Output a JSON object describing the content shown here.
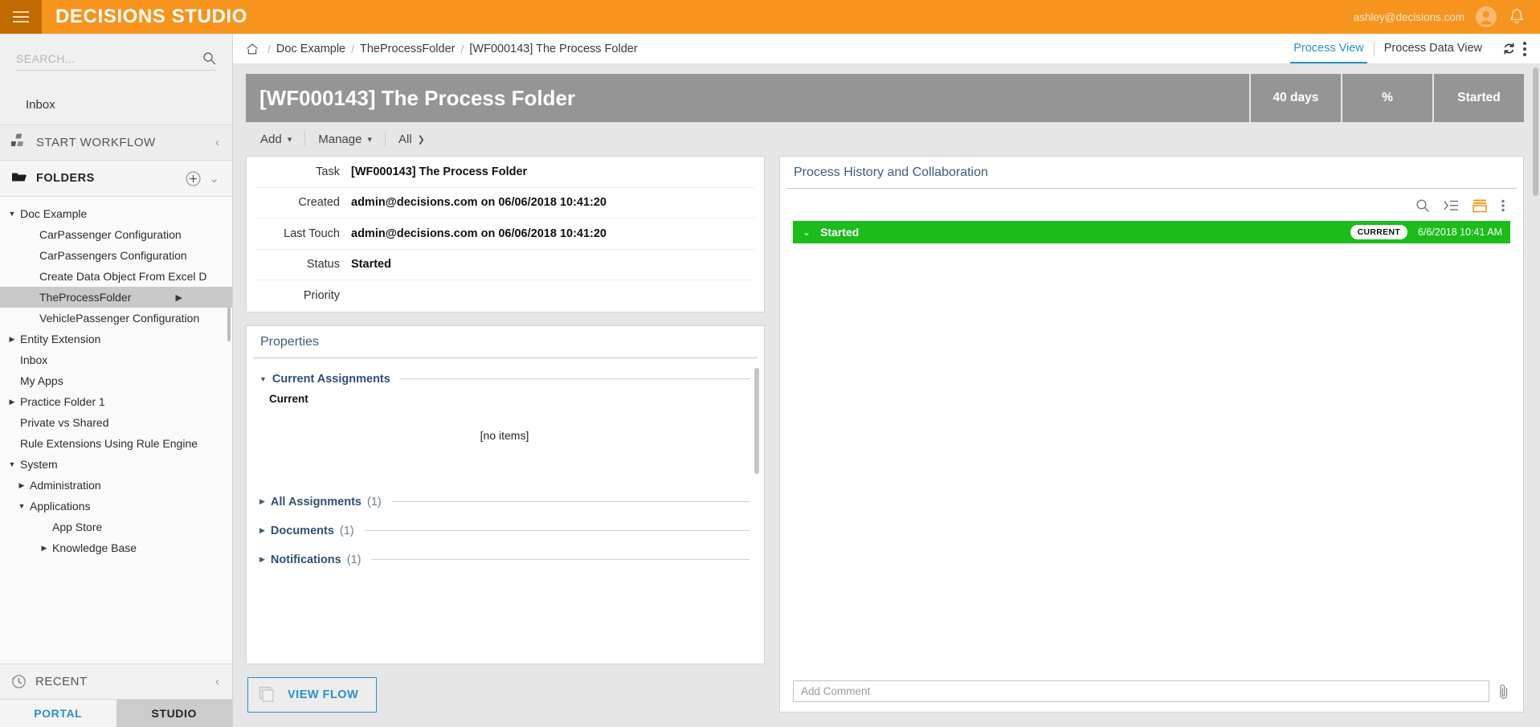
{
  "topbar": {
    "brand": "DECISIONS STUDIO",
    "user_email": "ashley@decisions.com",
    "menu_icon": "hamburger-icon",
    "avatar_icon": "user-avatar-icon",
    "bell_icon": "notification-bell-icon",
    "accent_color": "#f7941e",
    "menu_block_color": "#c06a00"
  },
  "sidebar": {
    "search": {
      "placeholder": "SEARCH...",
      "value": "",
      "icon": "search-icon"
    },
    "inbox_label": "Inbox",
    "start_workflow": {
      "label": "START WORKFLOW",
      "icon": "workflow-blocks-icon",
      "collapse": "‹"
    },
    "folders": {
      "label": "FOLDERS",
      "icon": "folder-icon",
      "add": "+",
      "chevron": "⌄"
    },
    "tree": [
      {
        "label": "Doc Example",
        "depth": 0,
        "arrow": "▼",
        "selected": false
      },
      {
        "label": "CarPassenger Configuration",
        "depth": 1,
        "arrow": "",
        "selected": false
      },
      {
        "label": "CarPassengers Configuration",
        "depth": 1,
        "arrow": "",
        "selected": false
      },
      {
        "label": "Create Data Object From Excel D",
        "depth": 1,
        "arrow": "",
        "selected": false
      },
      {
        "label": "TheProcessFolder",
        "depth": 1,
        "arrow": "",
        "selected": true,
        "right_arrow": "▶"
      },
      {
        "label": "VehiclePassenger Configuration",
        "depth": 1,
        "arrow": "",
        "selected": false
      },
      {
        "label": "Entity Extension",
        "depth": 0,
        "arrow": "▶",
        "selected": false
      },
      {
        "label": "Inbox",
        "depth": 0,
        "arrow": "",
        "selected": false
      },
      {
        "label": "My Apps",
        "depth": 0,
        "arrow": "",
        "selected": false
      },
      {
        "label": "Practice Folder 1",
        "depth": 0,
        "arrow": "▶",
        "selected": false
      },
      {
        "label": "Private vs Shared",
        "depth": 0,
        "arrow": "",
        "selected": false
      },
      {
        "label": "Rule Extensions Using Rule Engine",
        "depth": 0,
        "arrow": "",
        "selected": false
      },
      {
        "label": "System",
        "depth": 0,
        "arrow": "▼",
        "selected": false
      },
      {
        "label": "Administration",
        "depth": 2,
        "arrow": "▶",
        "selected": false
      },
      {
        "label": "Applications",
        "depth": 2,
        "arrow": "▼",
        "selected": false
      },
      {
        "label": "App Store",
        "depth": 3,
        "arrow": "",
        "selected": false
      },
      {
        "label": "Knowledge Base",
        "depth": 3,
        "arrow": "▶",
        "selected": false
      }
    ],
    "recent": {
      "label": "RECENT",
      "icon": "clock-icon",
      "collapse": "‹"
    },
    "bottom_tabs": [
      {
        "label": "PORTAL",
        "active": false
      },
      {
        "label": "STUDIO",
        "active": true
      }
    ]
  },
  "breadcrumb": {
    "home_icon": "home-icon",
    "separator": "/",
    "items": [
      "Doc Example",
      "TheProcessFolder",
      "[WF000143] The Process Folder"
    ]
  },
  "view_tabs": [
    {
      "label": "Process View",
      "active": true
    },
    {
      "label": "Process Data View",
      "active": false
    }
  ],
  "header_actions": {
    "refresh_icon": "refresh-icon",
    "kebab_icon": "more-vertical-icon"
  },
  "page_header": {
    "title": "[WF000143] The Process Folder",
    "stats": [
      {
        "label": "40 days"
      },
      {
        "label": "%"
      },
      {
        "label": "Started"
      }
    ],
    "bg_color": "#959595"
  },
  "toolbar": {
    "items": [
      {
        "label": "Add",
        "icon": "chevron-down-icon"
      },
      {
        "label": "Manage",
        "icon": "chevron-down-icon"
      },
      {
        "label": "All",
        "icon": "chevron-right-icon"
      }
    ]
  },
  "details": {
    "rows": [
      {
        "label": "Task",
        "value": "[WF000143] The Process Folder"
      },
      {
        "label": "Created",
        "value": "admin@decisions.com on 06/06/2018 10:41:20"
      },
      {
        "label": "Last Touch",
        "value": "admin@decisions.com on 06/06/2018 10:41:20"
      },
      {
        "label": "Status",
        "value": "Started"
      },
      {
        "label": "Priority",
        "value": ""
      }
    ]
  },
  "properties": {
    "title": "Properties",
    "current_assignments": {
      "label": "Current Assignments",
      "arrow": "▼",
      "count": "",
      "subhead": "Current",
      "empty_text": "[no items]"
    },
    "sections": [
      {
        "label": "All Assignments",
        "count": "(1)",
        "arrow": "▶"
      },
      {
        "label": "Documents",
        "count": "(1)",
        "arrow": "▶"
      },
      {
        "label": "Notifications",
        "count": "(1)",
        "arrow": "▶"
      }
    ]
  },
  "view_flow_button": {
    "label": "VIEW FLOW",
    "icon": "stacked-pages-icon"
  },
  "history": {
    "title": "Process History and Collaboration",
    "tools": [
      {
        "icon": "search-icon"
      },
      {
        "icon": "indent-list-icon"
      },
      {
        "icon": "layout-rows-icon"
      },
      {
        "icon": "more-vertical-icon"
      }
    ],
    "rows": [
      {
        "chevron": "⌄",
        "name": "Started",
        "badge": "CURRENT",
        "date": "6/6/2018 10:41 AM",
        "color": "#1bbc1b"
      }
    ],
    "comment": {
      "placeholder": "Add Comment",
      "value": "",
      "attach_icon": "paperclip-icon"
    }
  }
}
